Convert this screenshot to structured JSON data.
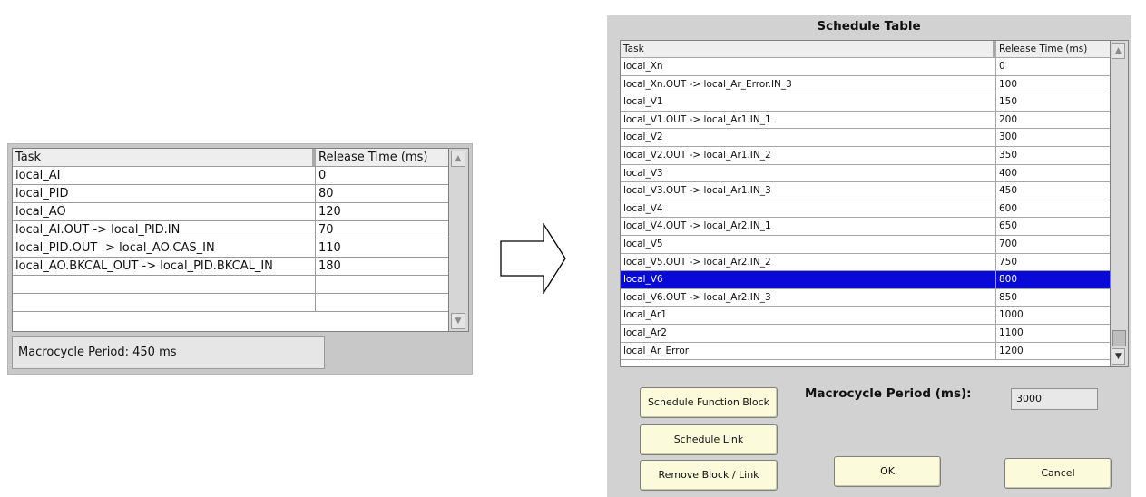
{
  "left": {
    "columns": [
      "Task",
      "Release Time (ms)"
    ],
    "rows": [
      [
        "local_AI",
        "0"
      ],
      [
        "local_PID",
        "80"
      ],
      [
        "local_AO",
        "120"
      ],
      [
        "local_AI.OUT -> local_PID.IN",
        "70"
      ],
      [
        "local_PID.OUT -> local_AO.CAS_IN",
        "110"
      ],
      [
        "local_AO.BKCAL_OUT -> local_PID.BKCAL_IN",
        "180"
      ],
      [
        "",
        ""
      ],
      [
        "",
        ""
      ]
    ],
    "macrocycle": "Macrocycle Period: 450 ms"
  },
  "dialog": {
    "title": "Schedule Table",
    "columns": [
      "Task",
      "Release Time (ms)"
    ],
    "rows": [
      [
        "local_Xn",
        "0"
      ],
      [
        "local_Xn.OUT -> local_Ar_Error.IN_3",
        "100"
      ],
      [
        "local_V1",
        "150"
      ],
      [
        "local_V1.OUT -> local_Ar1.IN_1",
        "200"
      ],
      [
        "local_V2",
        "300"
      ],
      [
        "local_V2.OUT -> local_Ar1.IN_2",
        "350"
      ],
      [
        "local_V3",
        "400"
      ],
      [
        "local_V3.OUT -> local_Ar1.IN_3",
        "450"
      ],
      [
        "local_V4",
        "600"
      ],
      [
        "local_V4.OUT -> local_Ar2.IN_1",
        "650"
      ],
      [
        "local_V5",
        "700"
      ],
      [
        "local_V5.OUT -> local_Ar2.IN_2",
        "750"
      ],
      [
        "local_V6",
        "800"
      ],
      [
        "local_V6.OUT -> local_Ar2.IN_3",
        "850"
      ],
      [
        "local_Ar1",
        "1000"
      ],
      [
        "local_Ar2",
        "1100"
      ],
      [
        "local_Ar_Error",
        "1200"
      ]
    ],
    "selected_row": 12,
    "buttons": {
      "schedule_function_block": "Schedule Function Block",
      "schedule_link": "Schedule Link",
      "remove_block_link": "Remove Block / Link",
      "ok": "OK",
      "cancel": "Cancel"
    },
    "macrocycle_label": "Macrocycle Period (ms):",
    "macrocycle_value": "3000"
  },
  "icons": {
    "scroll_up": "triangle-up-icon",
    "scroll_down": "triangle-down-icon",
    "arrow": "right-arrow-icon"
  },
  "colors": {
    "selected_row": "#0a0ad8",
    "button_bg": "#fbfbdc",
    "panel_bg": "#c8c8c8",
    "dialog_bg": "#d2d2d2"
  }
}
